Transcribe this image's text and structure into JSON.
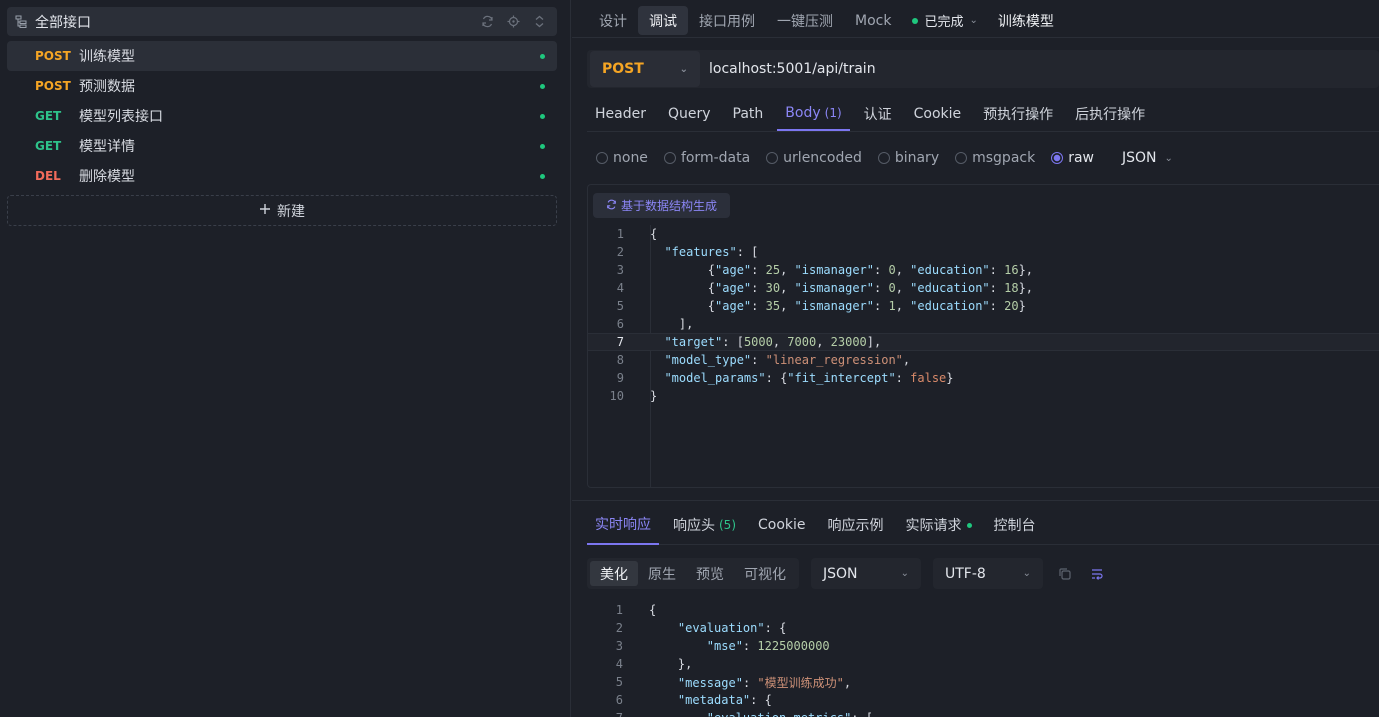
{
  "sidebar": {
    "header_title": "全部接口",
    "items": [
      {
        "method": "POST",
        "method_class": "m-post",
        "name": "训练模型",
        "active": true
      },
      {
        "method": "POST",
        "method_class": "m-post",
        "name": "预测数据",
        "active": false
      },
      {
        "method": "GET",
        "method_class": "m-get",
        "name": "模型列表接口",
        "active": false
      },
      {
        "method": "GET",
        "method_class": "m-get",
        "name": "模型详情",
        "active": false
      },
      {
        "method": "DEL",
        "method_class": "m-del",
        "name": "删除模型",
        "active": false
      }
    ],
    "new_label": "新建"
  },
  "topbar": {
    "mode_tabs": [
      "设计",
      "调试",
      "接口用例",
      "一键压测",
      "Mock"
    ],
    "active_mode": "调试",
    "status": "已完成",
    "api_title": "训练模型"
  },
  "request": {
    "method": "POST",
    "url": "localhost:5001/api/train",
    "tabs": [
      {
        "label": "Header",
        "count": ""
      },
      {
        "label": "Query",
        "count": ""
      },
      {
        "label": "Path",
        "count": ""
      },
      {
        "label": "Body",
        "count": "(1)"
      },
      {
        "label": "认证",
        "count": ""
      },
      {
        "label": "Cookie",
        "count": ""
      },
      {
        "label": "预执行操作",
        "count": ""
      },
      {
        "label": "后执行操作",
        "count": ""
      }
    ],
    "active_tab": "Body",
    "body_types": [
      "none",
      "form-data",
      "urlencoded",
      "binary",
      "msgpack",
      "raw"
    ],
    "selected_body_type": "raw",
    "format": "JSON",
    "generate_label": "基于数据结构生成",
    "current_line": 7,
    "body_lines": [
      "{",
      "  \"features\": [",
      "        {\"age\": 25, \"ismanager\": 0, \"education\": 16},",
      "        {\"age\": 30, \"ismanager\": 0, \"education\": 18},",
      "        {\"age\": 35, \"ismanager\": 1, \"education\": 20}",
      "    ],",
      "  \"target\": [5000, 7000, 23000],",
      "  \"model_type\": \"linear_regression\",",
      "  \"model_params\": {\"fit_intercept\": false}",
      "}"
    ]
  },
  "response": {
    "tabs": [
      {
        "label": "实时响应",
        "count": "",
        "dot": false
      },
      {
        "label": "响应头",
        "count": "(5)",
        "dot": false
      },
      {
        "label": "Cookie",
        "count": "",
        "dot": false
      },
      {
        "label": "响应示例",
        "count": "",
        "dot": false
      },
      {
        "label": "实际请求",
        "count": "",
        "dot": true
      },
      {
        "label": "控制台",
        "count": "",
        "dot": false
      }
    ],
    "active_tab": "实时响应",
    "view_modes": [
      "美化",
      "原生",
      "预览",
      "可视化"
    ],
    "active_view": "美化",
    "format": "JSON",
    "encoding": "UTF-8",
    "body_lines": [
      "{",
      "    \"evaluation\": {",
      "        \"mse\": 1225000000",
      "    },",
      "    \"message\": \"模型训练成功\",",
      "    \"metadata\": {",
      "        \"evaluation_metrics\": ["
    ]
  },
  "colors": {
    "accent": "#7c76f0",
    "post": "#f5a524",
    "get": "#2ec28a",
    "del": "#f26b5b",
    "success_dot": "#1fc77e"
  }
}
